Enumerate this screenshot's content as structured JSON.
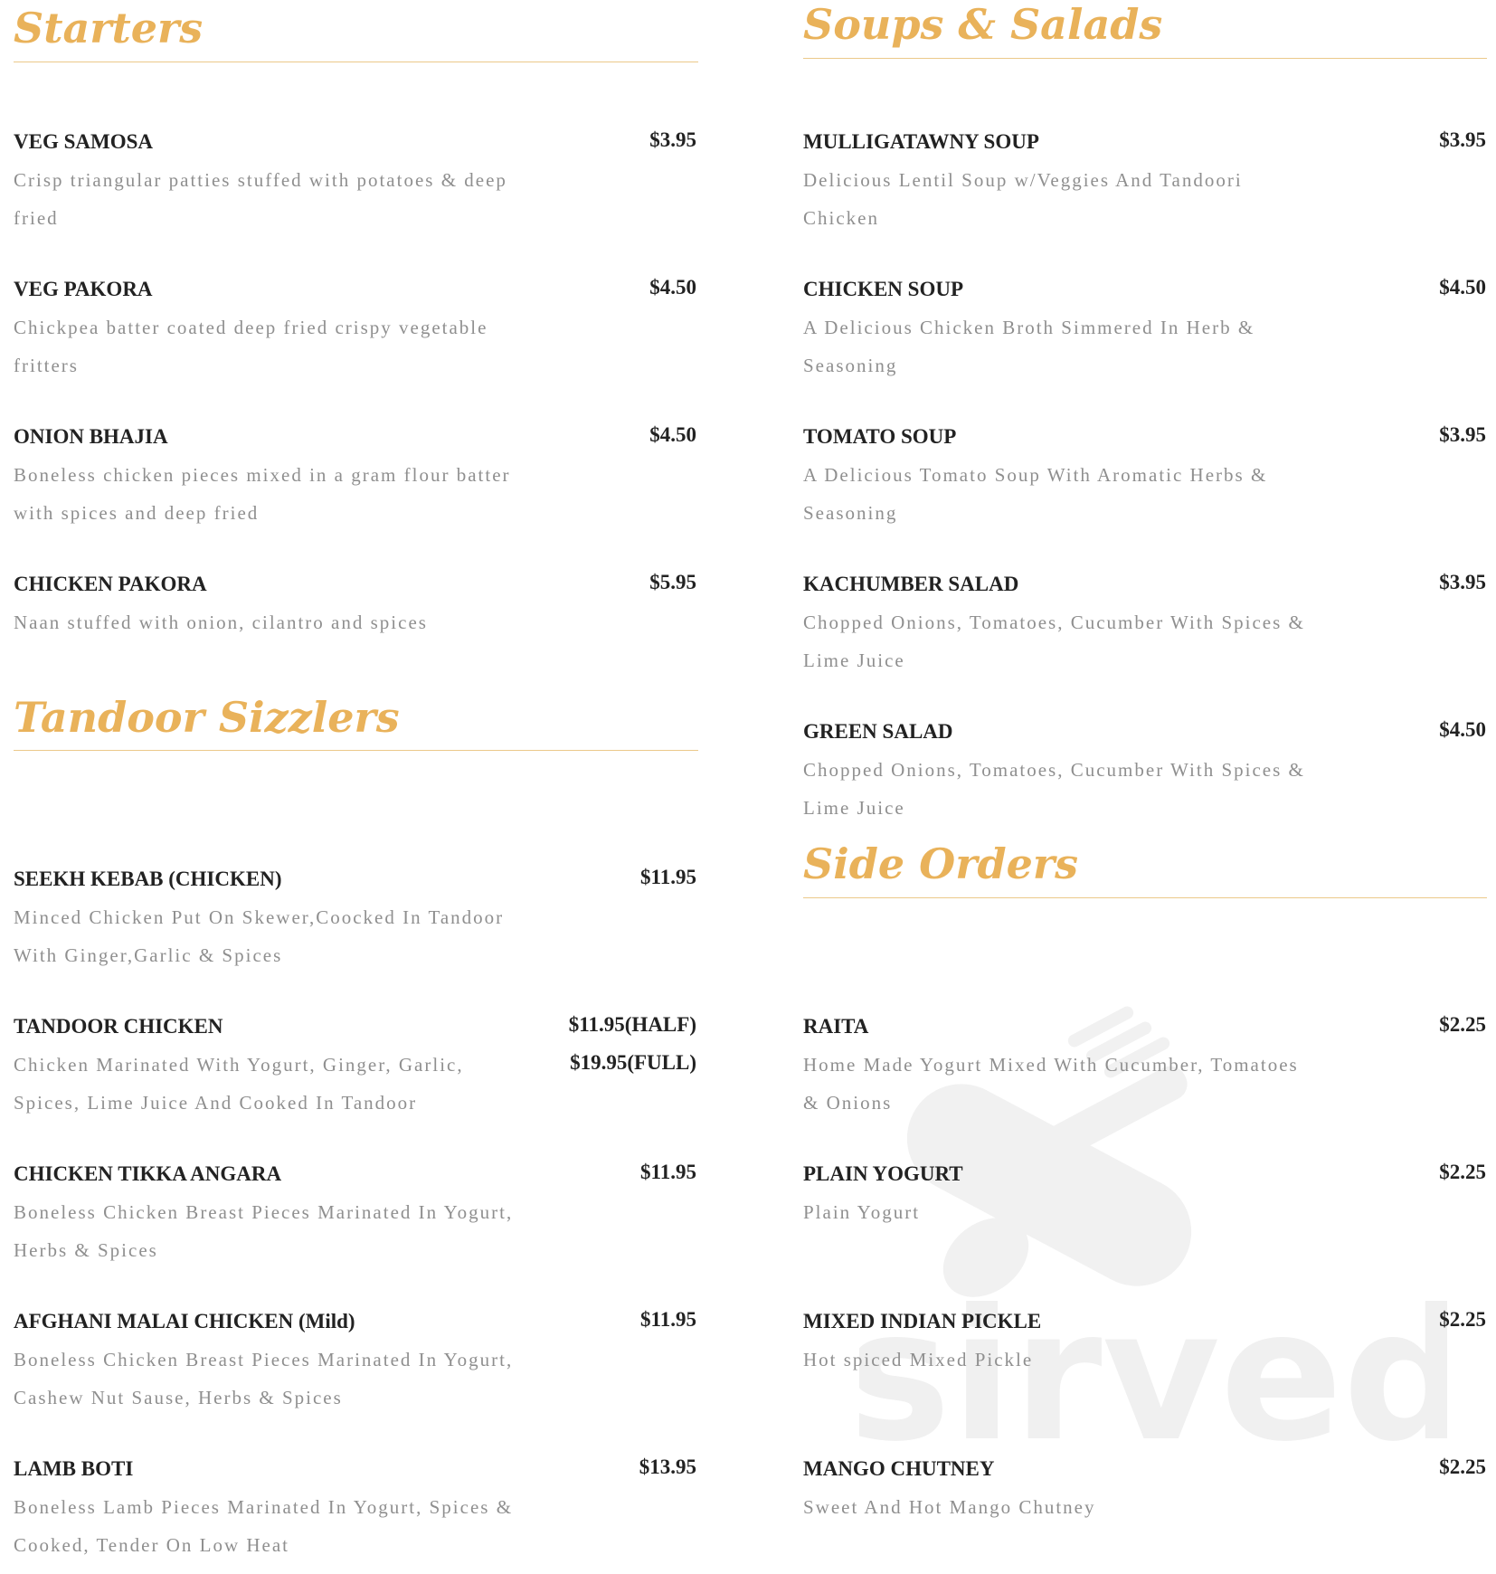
{
  "colors": {
    "accent": "#e9b25a",
    "item_name": "#222222",
    "description": "#8f8f8f"
  },
  "sections": {
    "starters": {
      "title": "Starters",
      "items": [
        {
          "name": "VEG SAMOSA",
          "price": "$3.95",
          "description": "Crisp triangular patties stuffed with potatoes & deep fried"
        },
        {
          "name": "VEG PAKORA",
          "price": "$4.50",
          "description": "Chickpea batter coated deep fried crispy vegetable fritters"
        },
        {
          "name": "ONION BHAJIA",
          "price": "$4.50",
          "description": "Boneless chicken pieces mixed in a gram flour batter with spices and deep fried"
        },
        {
          "name": "CHICKEN PAKORA",
          "price": "$5.95",
          "description": "Naan stuffed with onion, cilantro and spices"
        }
      ]
    },
    "soups_salads": {
      "title": "Soups & Salads",
      "items": [
        {
          "name": "MULLIGATAWNY  SOUP",
          "price": "$3.95",
          "description": "Delicious Lentil Soup w/Veggies And Tandoori Chicken"
        },
        {
          "name": "CHICKEN SOUP",
          "price": "$4.50",
          "description": "A Delicious Chicken Broth Simmered In Herb & Seasoning"
        },
        {
          "name": "TOMATO SOUP",
          "price": "$3.95",
          "description": "A Delicious Tomato Soup With Aromatic Herbs & Seasoning"
        },
        {
          "name": "KACHUMBER SALAD",
          "price": "$3.95",
          "description": "Chopped Onions, Tomatoes, Cucumber With Spices & Lime Juice"
        },
        {
          "name": "GREEN SALAD",
          "price": "$4.50",
          "description": "Chopped Onions, Tomatoes, Cucumber With Spices & Lime Juice"
        }
      ]
    },
    "tandoor_sizzlers": {
      "title": "Tandoor Sizzlers",
      "items": [
        {
          "name": "SEEKH KEBAB (CHICKEN)",
          "price": "$11.95",
          "description": "Minced Chicken Put On Skewer,Coocked In Tandoor With Ginger,Garlic & Spices"
        },
        {
          "name": "TANDOOR CHICKEN",
          "price": "$11.95(HALF)",
          "price2": "$19.95(FULL)",
          "description": "Chicken Marinated With Yogurt, Ginger, Garlic, Spices, Lime Juice And Cooked In Tandoor"
        },
        {
          "name": "CHICKEN TIKKA ANGARA",
          "price": "$11.95",
          "description": "Boneless Chicken Breast Pieces Marinated In Yogurt, Herbs & Spices"
        },
        {
          "name": "AFGHANI MALAI CHICKEN (Mild)",
          "price": "$11.95",
          "description": "Boneless Chicken Breast Pieces Marinated In Yogurt, Cashew Nut Sause, Herbs & Spices"
        },
        {
          "name": "LAMB BOTI",
          "price": "$13.95",
          "description": "Boneless Lamb Pieces Marinated In Yogurt, Spices & Cooked, Tender On Low Heat"
        }
      ]
    },
    "side_orders": {
      "title": "Side Orders",
      "items": [
        {
          "name": "RAITA",
          "price": "$2.25",
          "description": "Home Made Yogurt Mixed With Cucumber, Tomatoes & Onions"
        },
        {
          "name": "PLAIN YOGURT",
          "price": "$2.25",
          "description": "Plain Yogurt"
        },
        {
          "name": "MIXED INDIAN PICKLE",
          "price": "$2.25",
          "description": "Hot spiced Mixed Pickle"
        },
        {
          "name": "MANGO CHUTNEY",
          "price": "$2.25",
          "description": "Sweet And Hot Mango Chutney"
        }
      ]
    }
  },
  "watermark": {
    "text": "sirved",
    "icon": "fork-spoon-icon"
  }
}
